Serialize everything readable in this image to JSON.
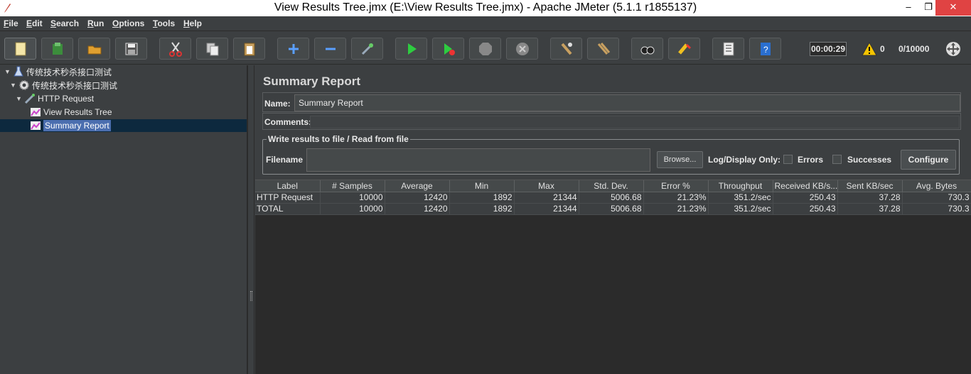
{
  "window": {
    "title": "View Results Tree.jmx (E:\\View Results Tree.jmx) - Apache JMeter (5.1.1 r1855137)",
    "min_glyph": "‒",
    "max_glyph": "❐",
    "close_glyph": "✕"
  },
  "menu": [
    {
      "label": "File",
      "ul": "F",
      "rest": "ile"
    },
    {
      "label": "Edit",
      "ul": "E",
      "rest": "dit"
    },
    {
      "label": "Search",
      "ul": "S",
      "rest": "earch"
    },
    {
      "label": "Run",
      "ul": "R",
      "rest": "un"
    },
    {
      "label": "Options",
      "ul": "O",
      "rest": "ptions"
    },
    {
      "label": "Tools",
      "ul": "T",
      "rest": "ools"
    },
    {
      "label": "Help",
      "ul": "H",
      "rest": "elp"
    }
  ],
  "toolbar": {
    "buttons": [
      "new-icon",
      "templates-icon",
      "open-icon",
      "save-icon",
      "cut-icon",
      "copy-icon",
      "paste-icon",
      "expand-icon",
      "collapse-icon",
      "toggle-icon",
      "start-icon",
      "start-no-pauses-icon",
      "stop-icon",
      "shutdown-icon",
      "clear-icon",
      "clear-all-icon",
      "search-icon",
      "reset-search-icon",
      "function-helper-icon",
      "help-icon"
    ],
    "timer": "00:00:29",
    "warning_count": "0",
    "thread_count": "0/10000"
  },
  "tree": {
    "test_plan": "传统技术秒杀接口测试",
    "thread_group": "传统技术秒杀接口测试",
    "sampler": "HTTP Request",
    "listener_1": "View Results Tree",
    "listener_2": "Summary Report"
  },
  "panel": {
    "title": "Summary Report",
    "name_label": "Name:",
    "name_value": "Summary Report",
    "comments_label": "Comments:",
    "fieldset_legend": "Write results to file / Read from file",
    "filename_label": "Filename",
    "browse_label": "Browse...",
    "log_display_label": "Log/Display Only:",
    "errors_label": "Errors",
    "successes_label": "Successes",
    "configure_label": "Configure"
  },
  "table": {
    "columns": [
      "Label",
      "# Samples",
      "Average",
      "Min",
      "Max",
      "Std. Dev.",
      "Error %",
      "Throughput",
      "Received KB/s...",
      "Sent KB/sec",
      "Avg. Bytes"
    ],
    "rows": [
      [
        "HTTP Request",
        "10000",
        "12420",
        "1892",
        "21344",
        "5006.68",
        "21.23%",
        "351.2/sec",
        "250.43",
        "37.28",
        "730.3"
      ],
      [
        "TOTAL",
        "10000",
        "12420",
        "1892",
        "21344",
        "5006.68",
        "21.23%",
        "351.2/sec",
        "250.43",
        "37.28",
        "730.3"
      ]
    ]
  }
}
